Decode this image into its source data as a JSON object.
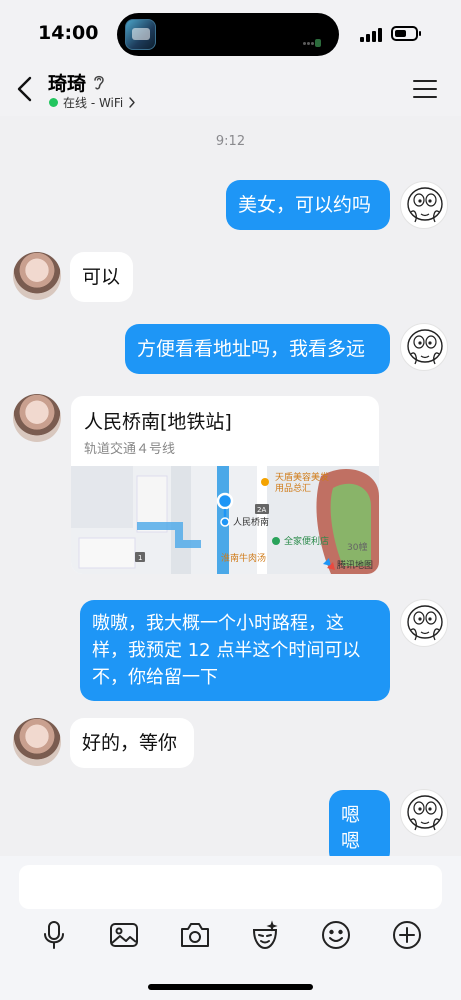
{
  "status_bar": {
    "time": "14:00"
  },
  "header": {
    "contact_name": "琦琦",
    "status": "在线 - WiFi",
    "online_color": "#22c55e"
  },
  "chat": {
    "timestamp": "9:12",
    "bubble_color": "#1e96f6",
    "messages": [
      {
        "direction": "out",
        "text": "美女，可以约吗"
      },
      {
        "direction": "in",
        "text": "可以"
      },
      {
        "direction": "out",
        "text": "方便看看地址吗，我看多远"
      },
      {
        "direction": "in",
        "type": "location",
        "title": "人民桥南[地铁站]",
        "subtitle": "轨道交通４号线",
        "map_labels": {
          "pin": "人民桥南",
          "poi_1_line_1": "天盾美容美发",
          "poi_1_line_2": "用品总汇",
          "poi_2": "全家便利店",
          "poi_3": "淮南牛肉汤",
          "building": "30幢",
          "exit_a": "2A",
          "exit_b": "1",
          "watermark": "腾讯地图"
        }
      },
      {
        "direction": "out",
        "lines": [
          "嗷嗷，我大概一个小时路程，这",
          "样，我预定 12 点半这个时间可以",
          "不，你给留一下"
        ]
      },
      {
        "direction": "in",
        "text": "好的，等你"
      },
      {
        "direction": "out",
        "text": "嗯嗯"
      }
    ]
  },
  "toolbar": {
    "icons": [
      "microphone-icon",
      "image-icon",
      "camera-icon",
      "sticker-icon",
      "emoji-icon",
      "plus-icon"
    ]
  }
}
